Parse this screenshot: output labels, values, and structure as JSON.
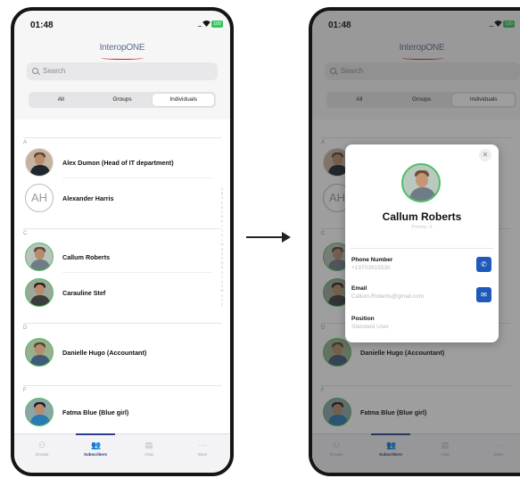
{
  "status": {
    "time": "01:48",
    "battery": "100"
  },
  "app": {
    "logo": "InteropONE"
  },
  "search": {
    "placeholder": "Search"
  },
  "segments": [
    "All",
    "Groups",
    "Individuals"
  ],
  "segment_active": "Individuals",
  "sections": [
    "A",
    "C",
    "D",
    "F"
  ],
  "contacts": [
    {
      "section": "A",
      "name": "Alex Dumon  (Head of IT department)",
      "avatar": "photo",
      "online": false
    },
    {
      "section": "A",
      "name": "Alexander Harris",
      "avatar": "AH",
      "online": false
    },
    {
      "section": "C",
      "name": "Callum Roberts",
      "avatar": "photo",
      "online": true
    },
    {
      "section": "C",
      "name": "Carauline Stef",
      "avatar": "photo",
      "online": true
    },
    {
      "section": "D",
      "name": "Danielle Hugo  (Accountant)",
      "avatar": "photo",
      "online": true
    },
    {
      "section": "F",
      "name": "Fatma Blue  (Blue girl)",
      "avatar": "photo",
      "online": true
    }
  ],
  "tabs": [
    {
      "label": "Groups",
      "icon": "groups-icon",
      "active": false
    },
    {
      "label": "Subscribers",
      "icon": "subscribers-icon",
      "active": true
    },
    {
      "label": "Chat",
      "icon": "chat-icon",
      "active": false
    },
    {
      "label": "More",
      "icon": "more-icon",
      "active": false
    }
  ],
  "modal": {
    "name": "Callum Roberts",
    "priority": "Priority: 9",
    "phone_label": "Phone Number",
    "phone_value": "+19703915530",
    "email_label": "Email",
    "email_value": "Callum.Roberts@gmail.com",
    "position_label": "Position",
    "position_value": "Standard User"
  },
  "colors": {
    "accent": "#1d3585",
    "action": "#1f59b9",
    "online": "#4fbf63",
    "brand_swoosh": "#c0283a"
  }
}
